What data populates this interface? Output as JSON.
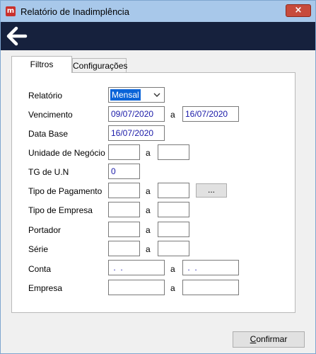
{
  "window": {
    "title": "Relatório de Inadimplência",
    "app_icon_glyph": "m",
    "close_glyph": "×",
    "back_icon": "arrow-left-icon"
  },
  "tabs": [
    {
      "label": "Filtros",
      "active": true
    },
    {
      "label": "Configurações",
      "active": false
    }
  ],
  "form": {
    "relatorio": {
      "label": "Relatório",
      "value": "Mensal"
    },
    "vencimento": {
      "label": "Vencimento",
      "from": "09/07/2020",
      "sep": "a",
      "to": "16/07/2020"
    },
    "data_base": {
      "label": "Data Base",
      "value": "16/07/2020"
    },
    "unidade_negocio": {
      "label": "Unidade de Negócio",
      "from": "",
      "sep": "a",
      "to": ""
    },
    "tg_un": {
      "label": "TG de U.N",
      "value": "0"
    },
    "tipo_pagamento": {
      "label": "Tipo de Pagamento",
      "from": "",
      "sep": "a",
      "to": "",
      "button": "..."
    },
    "tipo_empresa": {
      "label": "Tipo de Empresa",
      "from": "",
      "sep": "a",
      "to": ""
    },
    "portador": {
      "label": "Portador",
      "from": "",
      "sep": "a",
      "to": ""
    },
    "serie": {
      "label": "Série",
      "from": "",
      "sep": "a",
      "to": ""
    },
    "conta": {
      "label": "Conta",
      "from": " .  .",
      "sep": "a",
      "to": " .  ."
    },
    "empresa": {
      "label": "Empresa",
      "from": "",
      "sep": "a",
      "to": ""
    }
  },
  "footer": {
    "confirm_first": "C",
    "confirm_rest": "onfirmar"
  },
  "colors": {
    "titlebar": "#a8c8ea",
    "navbar": "#16213d",
    "field_text": "#1a1aa8",
    "selection": "#0a64d8",
    "close_button": "#c74b3c"
  }
}
